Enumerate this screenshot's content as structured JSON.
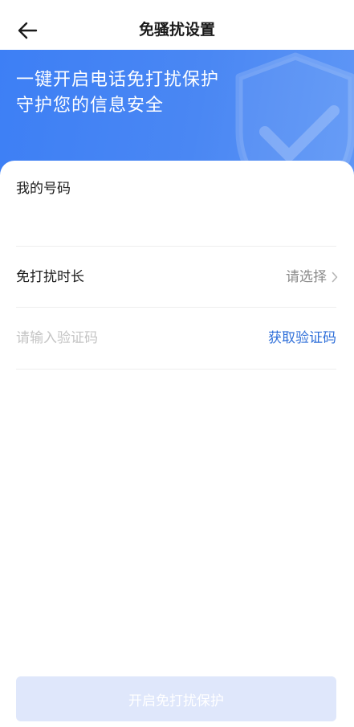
{
  "header": {
    "title": "免骚扰设置",
    "back_icon": "arrow-left-icon"
  },
  "banner": {
    "line1": "一键开启电话免打扰保护",
    "line2": "守护您的信息安全",
    "background_color": "#4a87f3",
    "decoration_icon": "shield-check-icon"
  },
  "form": {
    "phone_label": "我的号码",
    "phone_value": "",
    "duration_label": "免打扰时长",
    "duration_placeholder": "请选择",
    "duration_icon": "chevron-right-icon",
    "code_placeholder": "请输入验证码",
    "get_code_label": "获取验证码",
    "link_color": "#2f6fd9"
  },
  "submit": {
    "label": "开启免打扰保护",
    "state": "disabled",
    "background_color": "#dfe7fb"
  }
}
